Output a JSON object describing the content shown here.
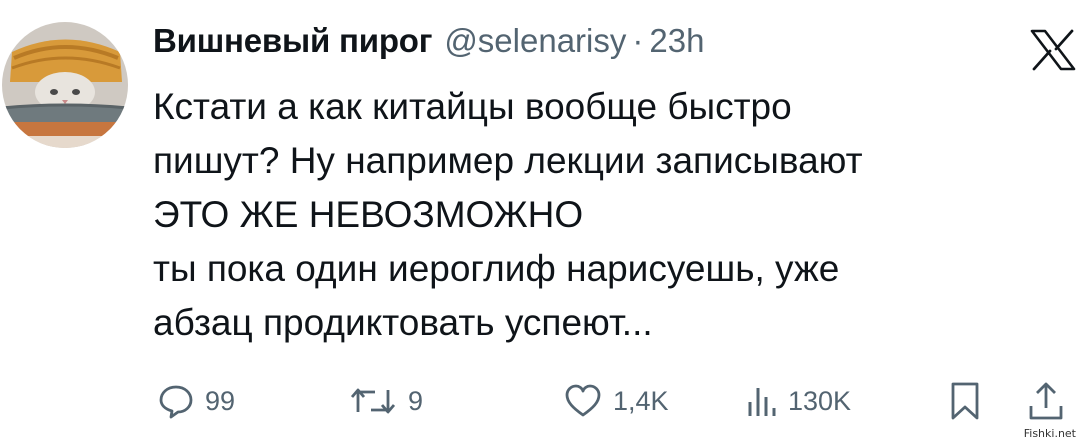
{
  "post": {
    "display_name": "Вишневый пирог",
    "handle": "@selenarisy",
    "separator": "·",
    "time": "23h",
    "lines": [
      "Кстати а как китайцы вообще быстро",
      "пишут? Ну например лекции записывают",
      "ЭТО ЖЕ НЕВОЗМОЖНО",
      "ты пока один иероглиф нарисуешь, уже",
      "абзац продиктовать успеют..."
    ]
  },
  "actions": {
    "replies": "99",
    "reposts": "9",
    "likes": "1,4K",
    "views": "130K"
  },
  "icons": {
    "platform": "x-logo-icon",
    "reply": "reply-icon",
    "repost": "repost-icon",
    "like": "heart-icon",
    "views": "views-chart-icon",
    "bookmark": "bookmark-icon",
    "share": "share-icon"
  },
  "colors": {
    "text": "#0f1419",
    "muted": "#536471"
  },
  "watermark": "Fishki.net"
}
